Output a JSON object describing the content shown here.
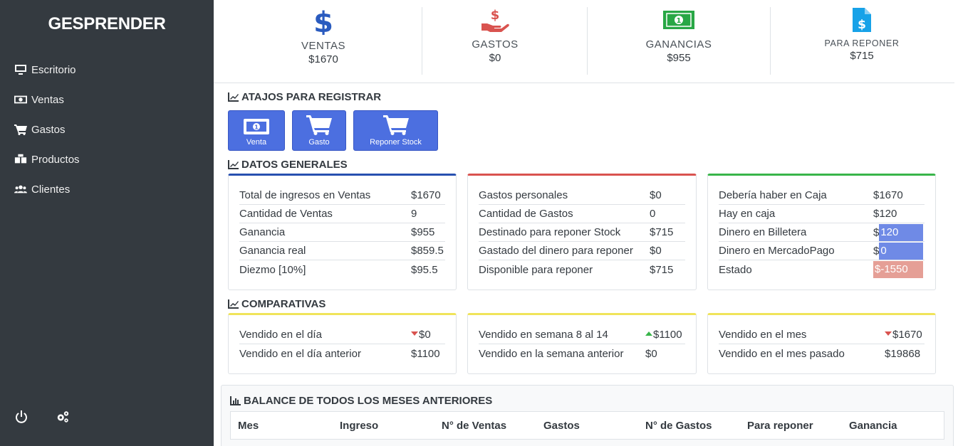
{
  "app": {
    "brand": "GESPRENDER"
  },
  "sidebar": {
    "items": [
      {
        "label": "Escritorio",
        "icon": "desktop-icon"
      },
      {
        "label": "Ventas",
        "icon": "money-icon"
      },
      {
        "label": "Gastos",
        "icon": "cart-icon"
      },
      {
        "label": "Productos",
        "icon": "boxes-icon"
      },
      {
        "label": "Clientes",
        "icon": "users-icon"
      }
    ],
    "footer": [
      "power-icon",
      "cogs-icon"
    ]
  },
  "stats": [
    {
      "label": "VENTAS",
      "value": "$1670",
      "icon": "dollar-icon",
      "color": "#2a5bbf"
    },
    {
      "label": "GASTOS",
      "value": "$0",
      "icon": "hand-dollar-icon",
      "color": "#d9534f"
    },
    {
      "label": "GANANCIAS",
      "value": "$955",
      "icon": "money-bill-icon",
      "color": "#28a745"
    },
    {
      "label": "PARA REPONER",
      "value": "$715",
      "icon": "file-invoice-dollar-icon",
      "color": "#17a2e8"
    }
  ],
  "shortcuts": {
    "title": "ATAJOS PARA REGISTRAR",
    "buttons": [
      "Venta",
      "Gasto",
      "Reponer Stock"
    ]
  },
  "general": {
    "title": "DATOS GENERALES",
    "ventas": [
      {
        "k": "Total de ingresos en Ventas",
        "v": "$1670"
      },
      {
        "k": "Cantidad de Ventas",
        "v": "9"
      },
      {
        "k": "Ganancia",
        "v": "$955"
      },
      {
        "k": "Ganancia real",
        "v": "$859.5"
      },
      {
        "k": "Diezmo [10%]",
        "v": "$95.5"
      }
    ],
    "gastos": [
      {
        "k": "Gastos personales",
        "v": "$0"
      },
      {
        "k": "Cantidad de Gastos",
        "v": "0"
      },
      {
        "k": "Destinado para reponer Stock",
        "v": "$715"
      },
      {
        "k": "Gastado del dinero para reponer",
        "v": "$0"
      },
      {
        "k": "Disponible para reponer",
        "v": "$715"
      }
    ],
    "caja": [
      {
        "k": "Debería haber en Caja",
        "v": "$1670"
      },
      {
        "k": "Hay en caja",
        "v": "$120"
      },
      {
        "k": "Dinero en Billetera",
        "prefix": "$",
        "v": "120"
      },
      {
        "k": "Dinero en MercadoPago",
        "prefix": "$",
        "v": "0"
      },
      {
        "k": "Estado",
        "v": "$-1550"
      }
    ]
  },
  "comparativas": {
    "title": "COMPARATIVAS",
    "dia": [
      {
        "k": "Vendido en el día",
        "v": "$0",
        "trend": "down"
      },
      {
        "k": "Vendido en el día anterior",
        "v": "$1100"
      }
    ],
    "semana": [
      {
        "k": "Vendido en semana 8 al 14",
        "v": "$1100",
        "trend": "up"
      },
      {
        "k": "Vendido en la semana anterior",
        "v": "$0"
      }
    ],
    "mes": [
      {
        "k": "Vendido en el mes",
        "v": "$1670",
        "trend": "down"
      },
      {
        "k": "Vendido en el mes pasado",
        "v": "$19868"
      }
    ]
  },
  "balance": {
    "title": "BALANCE DE TODOS LOS MESES ANTERIORES",
    "columns": [
      "Mes",
      "Ingreso",
      "N° de Ventas",
      "Gastos",
      "N° de Gastos",
      "Para reponer",
      "Ganancia"
    ]
  }
}
